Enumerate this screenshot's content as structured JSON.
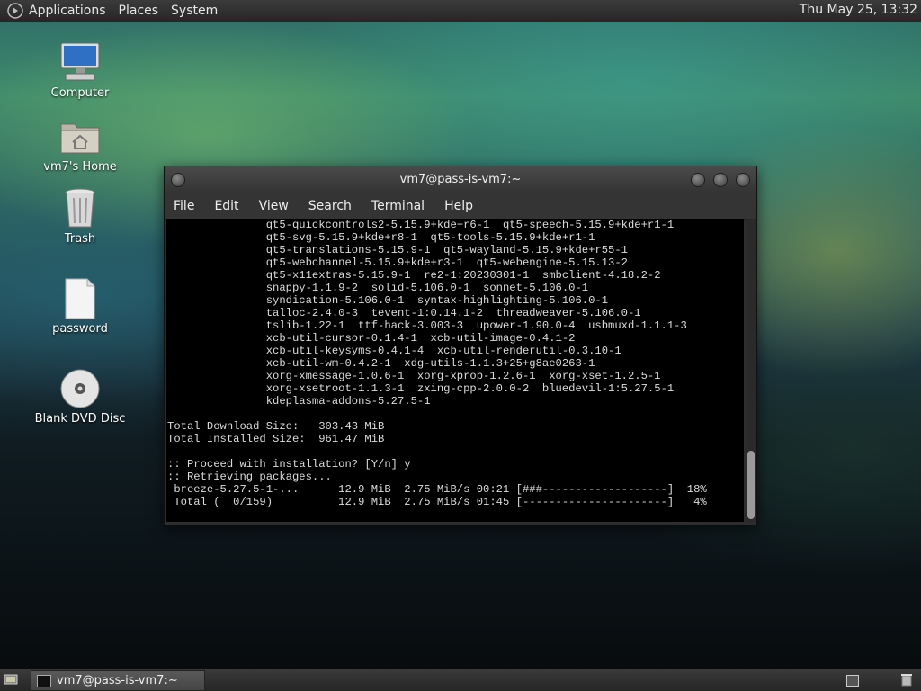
{
  "top_panel": {
    "menus": [
      "Applications",
      "Places",
      "System"
    ],
    "clock": "Thu May 25, 13:32"
  },
  "desktop_icons": [
    {
      "label": "Computer",
      "icon": "computer-icon"
    },
    {
      "label": "vm7's Home",
      "icon": "home-folder-icon"
    },
    {
      "label": "Trash",
      "icon": "trash-icon"
    },
    {
      "label": "password",
      "icon": "file-icon"
    },
    {
      "label": "Blank DVD Disc",
      "icon": "dvd-icon"
    }
  ],
  "terminal": {
    "title": "vm7@pass-is-vm7:~",
    "menu": [
      "File",
      "Edit",
      "View",
      "Search",
      "Terminal",
      "Help"
    ],
    "lines": [
      "               qt5-quickcontrols2-5.15.9+kde+r6-1  qt5-speech-5.15.9+kde+r1-1",
      "               qt5-svg-5.15.9+kde+r8-1  qt5-tools-5.15.9+kde+r1-1",
      "               qt5-translations-5.15.9-1  qt5-wayland-5.15.9+kde+r55-1",
      "               qt5-webchannel-5.15.9+kde+r3-1  qt5-webengine-5.15.13-2",
      "               qt5-x11extras-5.15.9-1  re2-1:20230301-1  smbclient-4.18.2-2",
      "               snappy-1.1.9-2  solid-5.106.0-1  sonnet-5.106.0-1",
      "               syndication-5.106.0-1  syntax-highlighting-5.106.0-1",
      "               talloc-2.4.0-3  tevent-1:0.14.1-2  threadweaver-5.106.0-1",
      "               tslib-1.22-1  ttf-hack-3.003-3  upower-1.90.0-4  usbmuxd-1.1.1-3",
      "               xcb-util-cursor-0.1.4-1  xcb-util-image-0.4.1-2",
      "               xcb-util-keysyms-0.4.1-4  xcb-util-renderutil-0.3.10-1",
      "               xcb-util-wm-0.4.2-1  xdg-utils-1.1.3+25+g8ae0263-1",
      "               xorg-xmessage-1.0.6-1  xorg-xprop-1.2.6-1  xorg-xset-1.2.5-1",
      "               xorg-xsetroot-1.1.3-1  zxing-cpp-2.0.0-2  bluedevil-1:5.27.5-1",
      "               kdeplasma-addons-5.27.5-1",
      "",
      "Total Download Size:   303.43 MiB",
      "Total Installed Size:  961.47 MiB",
      "",
      ":: Proceed with installation? [Y/n] y",
      ":: Retrieving packages...",
      " breeze-5.27.5-1-...      12.9 MiB  2.75 MiB/s 00:21 [###-------------------]  18%",
      " Total (  0/159)          12.9 MiB  2.75 MiB/s 01:45 [----------------------]   4%"
    ]
  },
  "bottom_panel": {
    "task_label": "vm7@pass-is-vm7:~"
  }
}
